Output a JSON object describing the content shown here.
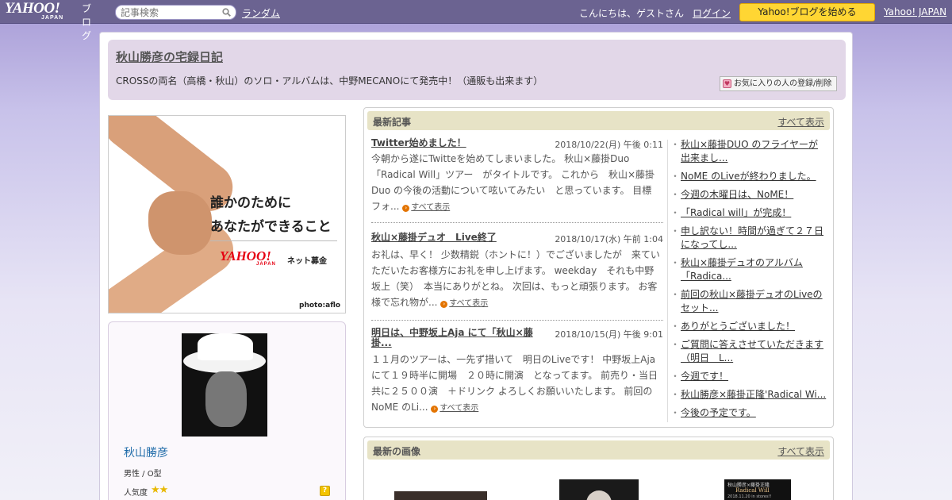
{
  "topbar": {
    "logo_main": "YAHOO!",
    "logo_sub": "JAPAN",
    "logo_blog": "ブログ",
    "search_placeholder": "記事検索",
    "random_link": "ランダム",
    "greeting": "こんにちは、ゲストさん",
    "login_link": "ログイン",
    "start_button": "Yahoo!ブログを始める",
    "yahoo_japan_link": "Yahoo! JAPAN"
  },
  "header": {
    "blog_title": "秋山勝彦の宅録日記",
    "description": "CROSSの両名（高橋・秋山）のソロ・アルバムは、中野MECANOにて発売中！（通販も出来ます）",
    "favorite_button": "お気に入りの人の登録/削除"
  },
  "banner": {
    "line1": "誰かのために",
    "line2": "あなたができること",
    "brand_main": "YAHOO!",
    "brand_sub": "JAPAN",
    "brand_tag": "ネット募金",
    "credit": "photo:aflo"
  },
  "profile": {
    "name": "秋山勝彦",
    "meta": "男性 / O型",
    "popularity_label": "人気度",
    "popularity_stars": "★★",
    "help_icon_text": "?"
  },
  "recent_articles": {
    "section_title": "最新記事",
    "see_all": "すべて表示",
    "read_more": "すべて表示",
    "ellipsis": "...",
    "articles": [
      {
        "title": "Twitter始めました！",
        "date": "2018/10/22(月) 午後 0:11",
        "body": "今朝から遂にTwitteを始めてしまいました。 秋山×藤掛Duo「Radical Will」ツアー　がタイトルです。 これから　秋山×藤掛Duo の今後の活動について呟いてみたい　と思っています。 目標　フォ"
      },
      {
        "title": "秋山×藤掛デュオ　Live終了",
        "date": "2018/10/17(水) 午前 1:04",
        "body": "お礼は、早く！ 少数精鋭（ホントに！）でございましたが　来ていただいたお客様方にお礼を申し上げます。 weekday　それも中野坂上（笑）　本当にありがとね。 次回は、もっと頑張ります。 お客様で忘れ物が"
      },
      {
        "title": "明日は、中野坂上Aja にて「秋山×藤掛...",
        "date": "2018/10/15(月) 午後 9:01",
        "body": "１１月のツアーは、一先ず措いて　明日のLiveです！ 中野坂上Aja にて１９時半に開場　２０時に開演　となってます。 前売り・当日共に２５００演　＋ドリンク よろしくお願いいたします。 前回のNoME のLi"
      }
    ],
    "sidebar_links": [
      "秋山×藤掛DUO のフライヤーが出来まし...",
      "NoME のLiveが終わりました。",
      "今週の木曜日は、NoME！",
      "「Radical will」が完成！",
      "申し訳ない！時間が過ぎて２７日になってし...",
      "秋山×藤掛デュオのアルバム「Radica...",
      "前回の秋山×藤掛デュオのLiveのセット...",
      "ありがとうございました！",
      "ご質問に答えさせていただきます（明日　L...",
      "今週です！",
      "秋山勝彦×藤掛正隆'Radical Wi...",
      "今後の予定です。"
    ]
  },
  "recent_images": {
    "section_title": "最新の画像",
    "see_all": "すべて表示",
    "thumb3_line1": "秋山勝彦×藤掛正隆",
    "thumb3_line2": "Radical Will",
    "thumb3_line3": "2018.11.20 in stores!!"
  }
}
